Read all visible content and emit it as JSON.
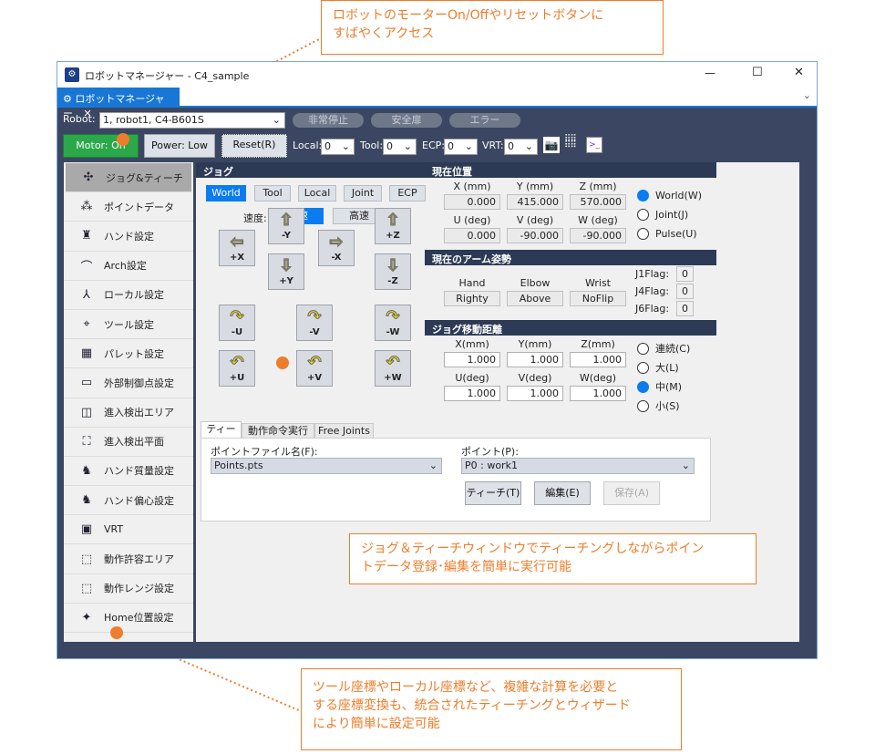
{
  "callouts": {
    "top": [
      "ロボットのモーターOn/Offやリセットボタンに",
      "すばやくアクセス"
    ],
    "middle": [
      "ジョグ＆ティーチウィンドウでティーチングしながらポイン",
      "トデータ登録･編集を簡単に実行可能"
    ],
    "bottom": [
      "ツール座標やローカル座標など、複雑な計算を必要と",
      "する座標変換も、統合されたティーチングとウィザード",
      "により簡単に設定可能"
    ]
  },
  "window": {
    "title": "ロボットマネージャー - C4_sample",
    "tab": "ロボットマネージャー",
    "minimize": "—",
    "maximize": "☐",
    "close": "✕",
    "tab_close": "✕",
    "tab_dropdown": "⌄"
  },
  "toolbar": {
    "robot_label": "Robot:",
    "robot_value": "1, robot1, C4-B601S",
    "estop": "非常停止",
    "safeguard": "安全扉",
    "error": "エラー",
    "motor": "Motor: On",
    "power": "Power: Low",
    "reset": "Reset(R)",
    "local_label": "Local:",
    "local_value": "0",
    "tool_label": "Tool:",
    "tool_value": "0",
    "ecp_label": "ECP:",
    "ecp_value": "0",
    "vrt_label": "VRT:",
    "vrt_value": "0"
  },
  "colors": {
    "accent": "#0a7cf0",
    "motor_on": "#2aa84a",
    "callout": "#ee7d2b",
    "header": "#2c3a55"
  },
  "sidebar": {
    "items": [
      {
        "label": "ジョグ&ティーチ",
        "icon": "✣"
      },
      {
        "label": "ポイントデータ",
        "icon": "⁂"
      },
      {
        "label": "ハンド設定",
        "icon": "♜"
      },
      {
        "label": "Arch設定",
        "icon": "⌒"
      },
      {
        "label": "ローカル設定",
        "icon": "⅄"
      },
      {
        "label": "ツール設定",
        "icon": "⌖"
      },
      {
        "label": "パレット設定",
        "icon": "▦"
      },
      {
        "label": "外部制御点設定",
        "icon": "▭"
      },
      {
        "label": "進入検出エリア",
        "icon": "◫"
      },
      {
        "label": "進入検出平面",
        "icon": "⛶"
      },
      {
        "label": "ハンド質量設定",
        "icon": "♞"
      },
      {
        "label": "ハンド偏心設定",
        "icon": "♞"
      },
      {
        "label": "VRT",
        "icon": "▣"
      },
      {
        "label": "動作許容エリア",
        "icon": "⬚"
      },
      {
        "label": "動作レンジ設定",
        "icon": "⬚"
      },
      {
        "label": "Home位置設定",
        "icon": "✦"
      }
    ]
  },
  "jog": {
    "header": "ジョグ",
    "modes": [
      "World",
      "Tool",
      "Local",
      "Joint",
      "ECP"
    ],
    "speed_label": "速度:",
    "speed_low": "低速",
    "speed_high": "高速",
    "buttons": {
      "px": "+X",
      "my": "-Y",
      "py": "+Y",
      "mx": "-X",
      "pz": "+Z",
      "mz": "-Z",
      "mu": "-U",
      "mv": "-V",
      "mw": "-W",
      "pu": "+U",
      "pv": "+V",
      "pw": "+W"
    }
  },
  "position": {
    "header": "現在位置",
    "labels": [
      "X (mm)",
      "Y (mm)",
      "Z (mm)",
      "U (deg)",
      "V (deg)",
      "W (deg)"
    ],
    "values": [
      "0.000",
      "415.000",
      "570.000",
      "0.000",
      "-90.000",
      "-90.000"
    ],
    "modes": [
      "World(W)",
      "Joint(J)",
      "Pulse(U)"
    ]
  },
  "arm": {
    "header": "現在のアーム姿勢",
    "labels": [
      "Hand",
      "Elbow",
      "Wrist"
    ],
    "values": [
      "Righty",
      "Above",
      "NoFlip"
    ],
    "flags": [
      {
        "label": "J1Flag:",
        "value": "0"
      },
      {
        "label": "J4Flag:",
        "value": "0"
      },
      {
        "label": "J6Flag:",
        "value": "0"
      }
    ]
  },
  "distance": {
    "header": "ジョグ移動距離",
    "labels": [
      "X(mm)",
      "Y(mm)",
      "Z(mm)",
      "U(deg)",
      "V(deg)",
      "W(deg)"
    ],
    "values": [
      "1.000",
      "1.000",
      "1.000",
      "1.000",
      "1.000",
      "1.000"
    ],
    "modes": [
      "連続(C)",
      "大(L)",
      "中(M)",
      "小(S)"
    ]
  },
  "teach": {
    "tabs": [
      "ティーチ",
      "動作命令実行",
      "Free Joints"
    ],
    "file_label": "ポイントファイル名(F):",
    "file_value": "Points.pts",
    "point_label": "ポイント(P):",
    "point_value": "P0 : work1",
    "teach_btn": "ティーチ(T)",
    "edit_btn": "編集(E)",
    "save_btn": "保存(A)"
  }
}
